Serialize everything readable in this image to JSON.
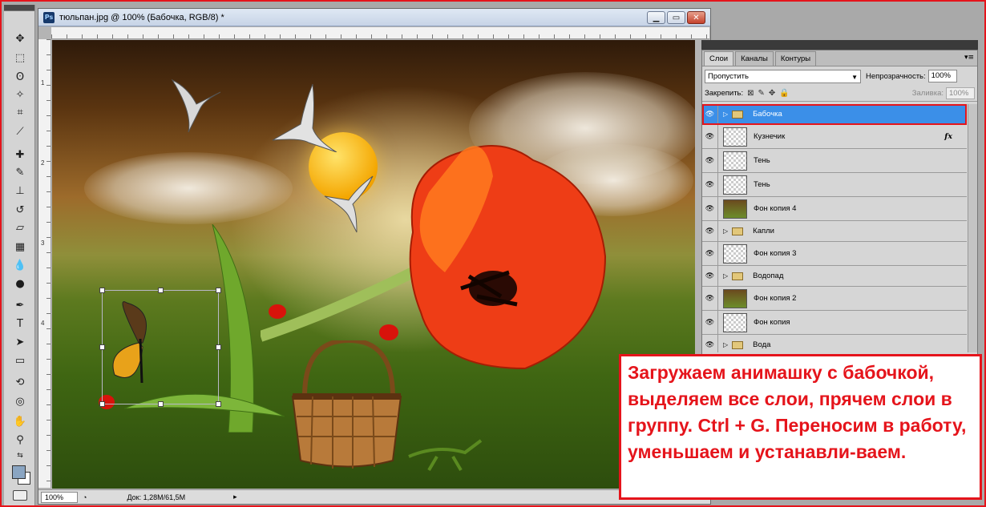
{
  "document": {
    "title": "тюльпан.jpg @ 100% (Бабочка, RGB/8) *",
    "app_icon": "Ps",
    "zoom": "100%",
    "doc_size": "Док: 1,28M/61,5M",
    "ruler_left_numbers": [
      "1",
      "2",
      "3",
      "4"
    ]
  },
  "window_buttons": {
    "minimize": "▁",
    "restore": "▭",
    "close": "✕"
  },
  "layers_panel": {
    "tabs": [
      "Слои",
      "Каналы",
      "Контуры"
    ],
    "panel_menu": "▾≡",
    "blend_mode": "Пропустить",
    "opacity_label": "Непрозрачность:",
    "opacity_value": "100%",
    "lock_label": "Закрепить:",
    "fill_label": "Заливка:",
    "fill_value": "100%",
    "layers": [
      {
        "name": "Бабочка",
        "type": "group",
        "selected": true
      },
      {
        "name": "Кузнечик",
        "type": "layer",
        "fx": "fx"
      },
      {
        "name": "Тень",
        "type": "layer"
      },
      {
        "name": "Тень",
        "type": "layer"
      },
      {
        "name": "Фон копия 4",
        "type": "layer",
        "photo": true
      },
      {
        "name": "Капли",
        "type": "group"
      },
      {
        "name": "Фон копия 3",
        "type": "layer"
      },
      {
        "name": "Водопад",
        "type": "group"
      },
      {
        "name": "Фон копия 2",
        "type": "layer",
        "photo": true
      },
      {
        "name": "Фон копия",
        "type": "layer"
      },
      {
        "name": "Вода",
        "type": "group"
      }
    ]
  },
  "annotation": "Загружаем анимашку с бабочкой, выделяем все слои, прячем слои в группу. Ctrl + G. Переносим в работу, уменьшаем и устанавли-ваем.",
  "colors": {
    "selection": "#3b8fe8",
    "annotation_red": "#e5141b",
    "foreground_swatch": "#8aa5c2"
  }
}
